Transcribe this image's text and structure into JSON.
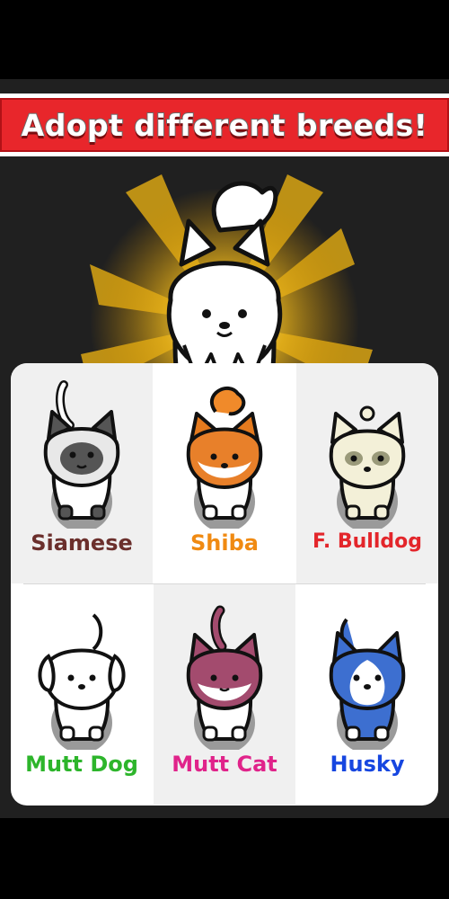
{
  "banner": {
    "title": "Adopt different breeds!"
  },
  "hero": {
    "pet_icon": "white-spitz-dog-icon"
  },
  "breeds": [
    {
      "label": "Siamese",
      "color": "#6b2f2c",
      "icon": "siamese-cat-icon"
    },
    {
      "label": "Shiba",
      "color": "#f08a12",
      "icon": "shiba-dog-icon"
    },
    {
      "label": "F. Bulldog",
      "color": "#e3262b",
      "icon": "french-bulldog-icon"
    },
    {
      "label": "Mutt Dog",
      "color": "#2db52b",
      "icon": "mutt-dog-icon"
    },
    {
      "label": "Mutt Cat",
      "color": "#e0238a",
      "icon": "mutt-cat-icon"
    },
    {
      "label": "Husky",
      "color": "#1646e0",
      "icon": "husky-dog-icon"
    }
  ]
}
